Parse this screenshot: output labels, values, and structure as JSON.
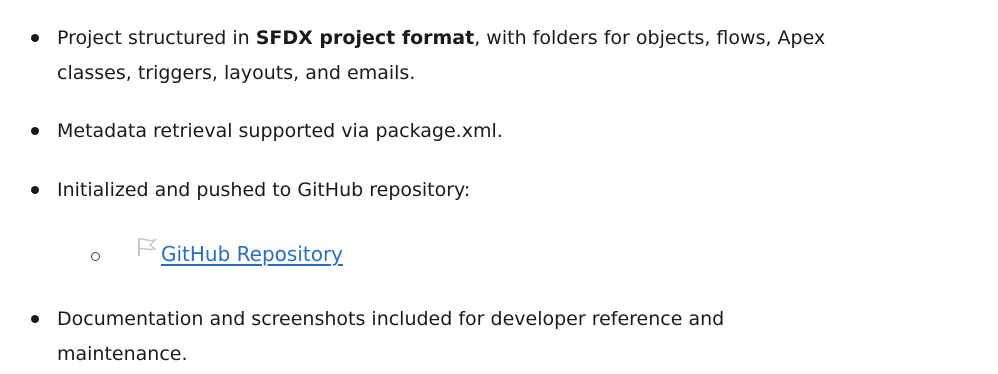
{
  "bullets": [
    {
      "line1_pre": "Project structured in ",
      "line1_bold": "SFDX project format",
      "line1_post": ", with folders for objects, flows, Apex",
      "line2": "classes, triggers, layouts, and emails."
    },
    {
      "text": "Metadata retrieval supported via package.xml."
    },
    {
      "text": "Initialized and pushed to GitHub repository:"
    },
    {
      "line1": "Documentation and screenshots included for developer reference and",
      "line2": "maintenance."
    }
  ],
  "sub_item": {
    "link_text": "GitHub Repository",
    "icon": "flag-icon",
    "link_color": "#2a6fbf"
  }
}
